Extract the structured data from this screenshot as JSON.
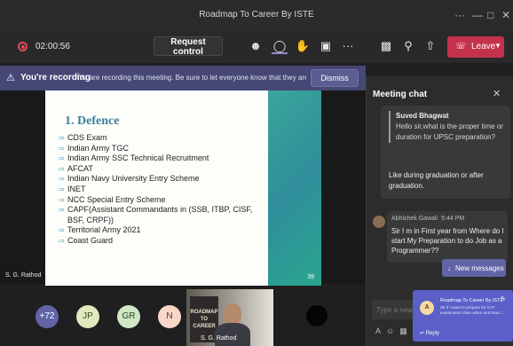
{
  "window": {
    "title": "Roadmap To Career By ISTE"
  },
  "toolbar": {
    "timer": "02:00:56",
    "request_control": "Request control",
    "leave_label": "Leave"
  },
  "recording_bar": {
    "title": "You're recording",
    "message": "You are recording this meeting. Be sure to let everyone know that they are...",
    "dismiss": "Dismiss"
  },
  "slide": {
    "title": "1. Defence",
    "items": [
      "CDS Exam",
      "Indian Army TGC",
      "Indian Army SSC Technical Recruitment",
      "AFCAT",
      "Indian Navy University Entry Scheme",
      "INET",
      "NCC Special Entry Scheme",
      "CAPF(Assistant Commandants in (SSB, ITBP, CISF, BSF, CRPF))",
      "Territorial Army 2021",
      "Coast Guard"
    ],
    "page_number": "39",
    "presenter": "S. G. Rathod"
  },
  "participants": {
    "overflow": "+72",
    "avatars": [
      {
        "initials": "JP",
        "color": "#dfe9bd"
      },
      {
        "initials": "GR",
        "color": "#cfe7c5"
      },
      {
        "initials": "N",
        "color": "#f7d7c8"
      }
    ],
    "video_name": "S. G. Rathod",
    "video_poster": "ROADMAP TO CAREER"
  },
  "chat": {
    "header": "Meeting chat",
    "messages": [
      {
        "quote_author": "Suved Bhagwat",
        "quote_text": "Hello sir,what is the proper time or duration for UPSC preparation?",
        "reply": "Like during graduation or after graduation."
      },
      {
        "author": "Abhishek Gawali",
        "time": "5:44 PM",
        "text": "Sir I m in First year from Where do I start My Preparation to do Job as a Programmer??"
      }
    ],
    "new_messages": "New messages",
    "compose_placeholder": "Type a new"
  },
  "toast": {
    "avatar": "A",
    "title": "Roadmap To Career By ISTE",
    "text": "Sir if I want to prepare for CAT examination then when and how t...",
    "reply": "Reply"
  },
  "colors": {
    "accent": "#6264a7",
    "leave": "#c4314b",
    "recording_bar": "#464775",
    "slide_title": "#3e7f9d"
  }
}
